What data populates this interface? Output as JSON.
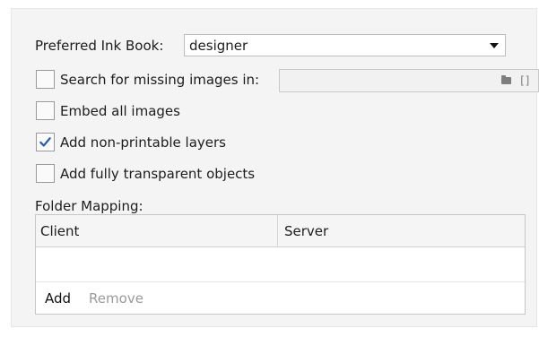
{
  "ink_book": {
    "label": "Preferred Ink Book:",
    "value": "designer"
  },
  "options": {
    "search_missing": {
      "label": "Search for missing images in:",
      "checked": false,
      "path_value": ""
    },
    "embed_all": {
      "label": "Embed all images",
      "checked": false
    },
    "non_printable": {
      "label": "Add non-printable layers",
      "checked": true
    },
    "transparent": {
      "label": "Add fully transparent objects",
      "checked": false
    }
  },
  "folder_mapping": {
    "label": "Folder Mapping:",
    "columns": [
      "Client",
      "Server"
    ],
    "rows": [],
    "add_label": "Add",
    "remove_label": "Remove"
  },
  "icons": {
    "dropdown": "chevron-down-icon",
    "folder": "folder-icon",
    "brackets": "brackets-icon",
    "check": "checkmark-icon"
  },
  "colors": {
    "panel_bg": "#f4f4f4",
    "check_color": "#2a5da8",
    "disabled_text": "#9a9a9a"
  }
}
